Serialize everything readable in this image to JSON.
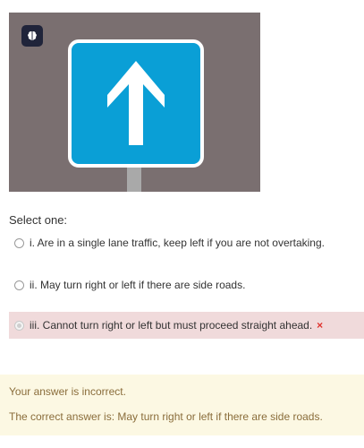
{
  "question_image": {
    "badge_icon": "brain-icon",
    "sign_icon": "up-arrow-icon",
    "colors": {
      "background": "#7a6f70",
      "sign_blue": "#0a9fd6",
      "sign_border": "#ffffff",
      "pole": "#a9a9a9"
    }
  },
  "select_label": "Select one:",
  "options": [
    {
      "label": "i. Are in a single lane traffic, keep left if you are not overtaking.",
      "selected": false
    },
    {
      "label": "ii. May turn right or left if there are side roads.",
      "selected": false
    },
    {
      "label": "iii. Cannot turn right or left but must proceed straight ahead.",
      "selected": true,
      "mark": "×"
    }
  ],
  "feedback": {
    "status": "Your answer is incorrect.",
    "correct_answer": "The correct answer is: May turn right or left if there are side roads."
  },
  "colors": {
    "incorrect_bg": "#f0dadb",
    "incorrect_mark": "#e0342f",
    "feedback_bg": "#fcf8e3",
    "feedback_text": "#8a6d3b"
  }
}
